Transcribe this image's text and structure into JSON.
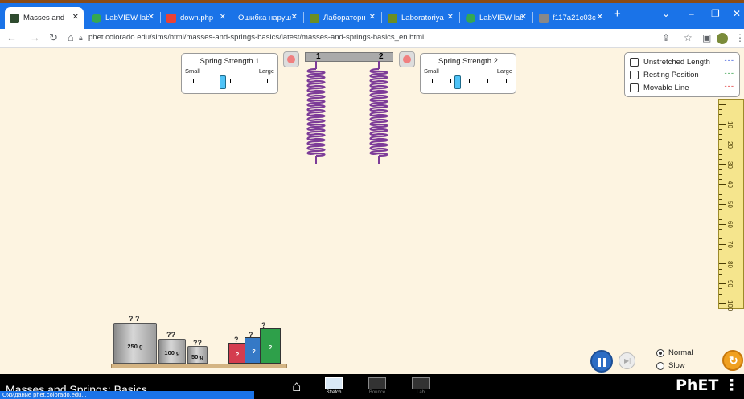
{
  "browser": {
    "tabs": [
      {
        "label": "Masses and S",
        "active": true,
        "icon_color": "#2f4b2f"
      },
      {
        "label": "LabVIEW lab",
        "active": false,
        "icon_color": "#34a853"
      },
      {
        "label": "down.php",
        "active": false,
        "icon_color": "#e94235"
      },
      {
        "label": "Ошибка нарушен",
        "active": false,
        "icon_color": "#ffffff"
      },
      {
        "label": "Лабораторн",
        "active": false,
        "icon_color": "#6b8e23"
      },
      {
        "label": "Laboratoriya",
        "active": false,
        "icon_color": "#6b8e23"
      },
      {
        "label": "LabVIEW lab",
        "active": false,
        "icon_color": "#34a853"
      },
      {
        "label": "f117a21c03c",
        "active": false,
        "icon_color": "#888888"
      }
    ],
    "new_tab": "+",
    "url": "phet.colorado.edu/sims/html/masses-and-springs-basics/latest/masses-and-springs-basics_en.html",
    "status_text": "Ожидание phet.colorado.edu..."
  },
  "sim": {
    "spring1_panel": {
      "title": "Spring Strength 1",
      "min_label": "Small",
      "max_label": "Large",
      "value": 0.4
    },
    "spring2_panel": {
      "title": "Spring Strength 2",
      "min_label": "Small",
      "max_label": "Large",
      "value": 0.35
    },
    "ceiling": {
      "label1": "1",
      "label2": "2"
    },
    "visibility": [
      {
        "label": "Unstretched Length",
        "dash": "---",
        "color": "#3b5bdb",
        "checked": false
      },
      {
        "label": "Resting Position",
        "dash": "---",
        "color": "#2f9e44",
        "checked": false
      },
      {
        "label": "Movable Line",
        "dash": "---",
        "color": "#e03131",
        "checked": false
      }
    ],
    "ruler_labels": [
      "10",
      "20",
      "30",
      "40",
      "50",
      "60",
      "70",
      "80",
      "90",
      "100"
    ],
    "masses": [
      {
        "label": "250 g",
        "hook": "? ?"
      },
      {
        "label": "100 g",
        "hook": "??"
      },
      {
        "label": "50 g",
        "hook": "??"
      }
    ],
    "mystery_masses": [
      {
        "label": "?",
        "color": "#d43d4f"
      },
      {
        "label": "?",
        "color": "#3579c6"
      },
      {
        "label": "?",
        "color": "#2ea04a"
      }
    ],
    "mystery_hooks": [
      "?",
      "?",
      "?"
    ],
    "speed": {
      "normal": "Normal",
      "slow": "Slow",
      "selected": "Normal"
    }
  },
  "navbar": {
    "title": "Masses and Springs: Basics",
    "screens": [
      {
        "label": "Stretch"
      },
      {
        "label": "Bounce"
      },
      {
        "label": "Lab"
      }
    ],
    "logo": "PhET"
  }
}
